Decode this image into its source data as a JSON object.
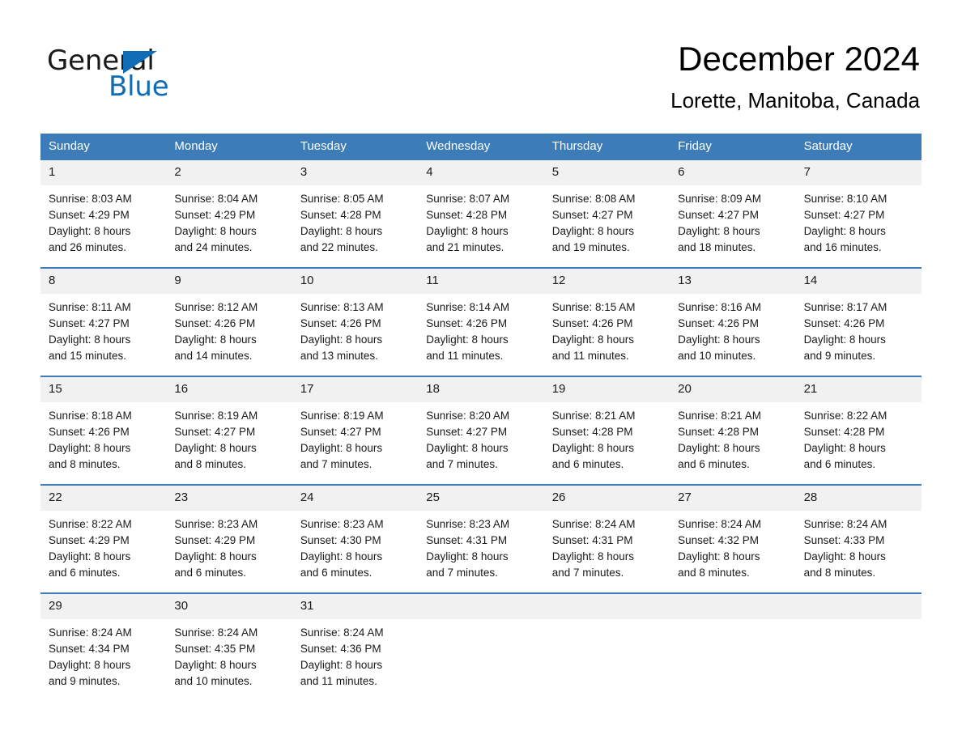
{
  "brand": {
    "word1": "General",
    "word2": "Blue",
    "triangle_color": "#0f6cb5"
  },
  "header": {
    "month_title": "December 2024",
    "location": "Lorette, Manitoba, Canada"
  },
  "theme": {
    "header_blue": "#3c7cb9",
    "date_band_gray": "#f1f1f1",
    "text_black": "#1a1a1a",
    "white": "#ffffff"
  },
  "calendar": {
    "weekdays": [
      "Sunday",
      "Monday",
      "Tuesday",
      "Wednesday",
      "Thursday",
      "Friday",
      "Saturday"
    ],
    "weeks": [
      [
        {
          "date": "1",
          "lines": [
            "Sunrise: 8:03 AM",
            "Sunset: 4:29 PM",
            "Daylight: 8 hours",
            "and 26 minutes."
          ]
        },
        {
          "date": "2",
          "lines": [
            "Sunrise: 8:04 AM",
            "Sunset: 4:29 PM",
            "Daylight: 8 hours",
            "and 24 minutes."
          ]
        },
        {
          "date": "3",
          "lines": [
            "Sunrise: 8:05 AM",
            "Sunset: 4:28 PM",
            "Daylight: 8 hours",
            "and 22 minutes."
          ]
        },
        {
          "date": "4",
          "lines": [
            "Sunrise: 8:07 AM",
            "Sunset: 4:28 PM",
            "Daylight: 8 hours",
            "and 21 minutes."
          ]
        },
        {
          "date": "5",
          "lines": [
            "Sunrise: 8:08 AM",
            "Sunset: 4:27 PM",
            "Daylight: 8 hours",
            "and 19 minutes."
          ]
        },
        {
          "date": "6",
          "lines": [
            "Sunrise: 8:09 AM",
            "Sunset: 4:27 PM",
            "Daylight: 8 hours",
            "and 18 minutes."
          ]
        },
        {
          "date": "7",
          "lines": [
            "Sunrise: 8:10 AM",
            "Sunset: 4:27 PM",
            "Daylight: 8 hours",
            "and 16 minutes."
          ]
        }
      ],
      [
        {
          "date": "8",
          "lines": [
            "Sunrise: 8:11 AM",
            "Sunset: 4:27 PM",
            "Daylight: 8 hours",
            "and 15 minutes."
          ]
        },
        {
          "date": "9",
          "lines": [
            "Sunrise: 8:12 AM",
            "Sunset: 4:26 PM",
            "Daylight: 8 hours",
            "and 14 minutes."
          ]
        },
        {
          "date": "10",
          "lines": [
            "Sunrise: 8:13 AM",
            "Sunset: 4:26 PM",
            "Daylight: 8 hours",
            "and 13 minutes."
          ]
        },
        {
          "date": "11",
          "lines": [
            "Sunrise: 8:14 AM",
            "Sunset: 4:26 PM",
            "Daylight: 8 hours",
            "and 11 minutes."
          ]
        },
        {
          "date": "12",
          "lines": [
            "Sunrise: 8:15 AM",
            "Sunset: 4:26 PM",
            "Daylight: 8 hours",
            "and 11 minutes."
          ]
        },
        {
          "date": "13",
          "lines": [
            "Sunrise: 8:16 AM",
            "Sunset: 4:26 PM",
            "Daylight: 8 hours",
            "and 10 minutes."
          ]
        },
        {
          "date": "14",
          "lines": [
            "Sunrise: 8:17 AM",
            "Sunset: 4:26 PM",
            "Daylight: 8 hours",
            "and 9 minutes."
          ]
        }
      ],
      [
        {
          "date": "15",
          "lines": [
            "Sunrise: 8:18 AM",
            "Sunset: 4:26 PM",
            "Daylight: 8 hours",
            "and 8 minutes."
          ]
        },
        {
          "date": "16",
          "lines": [
            "Sunrise: 8:19 AM",
            "Sunset: 4:27 PM",
            "Daylight: 8 hours",
            "and 8 minutes."
          ]
        },
        {
          "date": "17",
          "lines": [
            "Sunrise: 8:19 AM",
            "Sunset: 4:27 PM",
            "Daylight: 8 hours",
            "and 7 minutes."
          ]
        },
        {
          "date": "18",
          "lines": [
            "Sunrise: 8:20 AM",
            "Sunset: 4:27 PM",
            "Daylight: 8 hours",
            "and 7 minutes."
          ]
        },
        {
          "date": "19",
          "lines": [
            "Sunrise: 8:21 AM",
            "Sunset: 4:28 PM",
            "Daylight: 8 hours",
            "and 6 minutes."
          ]
        },
        {
          "date": "20",
          "lines": [
            "Sunrise: 8:21 AM",
            "Sunset: 4:28 PM",
            "Daylight: 8 hours",
            "and 6 minutes."
          ]
        },
        {
          "date": "21",
          "lines": [
            "Sunrise: 8:22 AM",
            "Sunset: 4:28 PM",
            "Daylight: 8 hours",
            "and 6 minutes."
          ]
        }
      ],
      [
        {
          "date": "22",
          "lines": [
            "Sunrise: 8:22 AM",
            "Sunset: 4:29 PM",
            "Daylight: 8 hours",
            "and 6 minutes."
          ]
        },
        {
          "date": "23",
          "lines": [
            "Sunrise: 8:23 AM",
            "Sunset: 4:29 PM",
            "Daylight: 8 hours",
            "and 6 minutes."
          ]
        },
        {
          "date": "24",
          "lines": [
            "Sunrise: 8:23 AM",
            "Sunset: 4:30 PM",
            "Daylight: 8 hours",
            "and 6 minutes."
          ]
        },
        {
          "date": "25",
          "lines": [
            "Sunrise: 8:23 AM",
            "Sunset: 4:31 PM",
            "Daylight: 8 hours",
            "and 7 minutes."
          ]
        },
        {
          "date": "26",
          "lines": [
            "Sunrise: 8:24 AM",
            "Sunset: 4:31 PM",
            "Daylight: 8 hours",
            "and 7 minutes."
          ]
        },
        {
          "date": "27",
          "lines": [
            "Sunrise: 8:24 AM",
            "Sunset: 4:32 PM",
            "Daylight: 8 hours",
            "and 8 minutes."
          ]
        },
        {
          "date": "28",
          "lines": [
            "Sunrise: 8:24 AM",
            "Sunset: 4:33 PM",
            "Daylight: 8 hours",
            "and 8 minutes."
          ]
        }
      ],
      [
        {
          "date": "29",
          "lines": [
            "Sunrise: 8:24 AM",
            "Sunset: 4:34 PM",
            "Daylight: 8 hours",
            "and 9 minutes."
          ]
        },
        {
          "date": "30",
          "lines": [
            "Sunrise: 8:24 AM",
            "Sunset: 4:35 PM",
            "Daylight: 8 hours",
            "and 10 minutes."
          ]
        },
        {
          "date": "31",
          "lines": [
            "Sunrise: 8:24 AM",
            "Sunset: 4:36 PM",
            "Daylight: 8 hours",
            "and 11 minutes."
          ]
        },
        {
          "date": "",
          "lines": []
        },
        {
          "date": "",
          "lines": []
        },
        {
          "date": "",
          "lines": []
        },
        {
          "date": "",
          "lines": []
        }
      ]
    ]
  }
}
